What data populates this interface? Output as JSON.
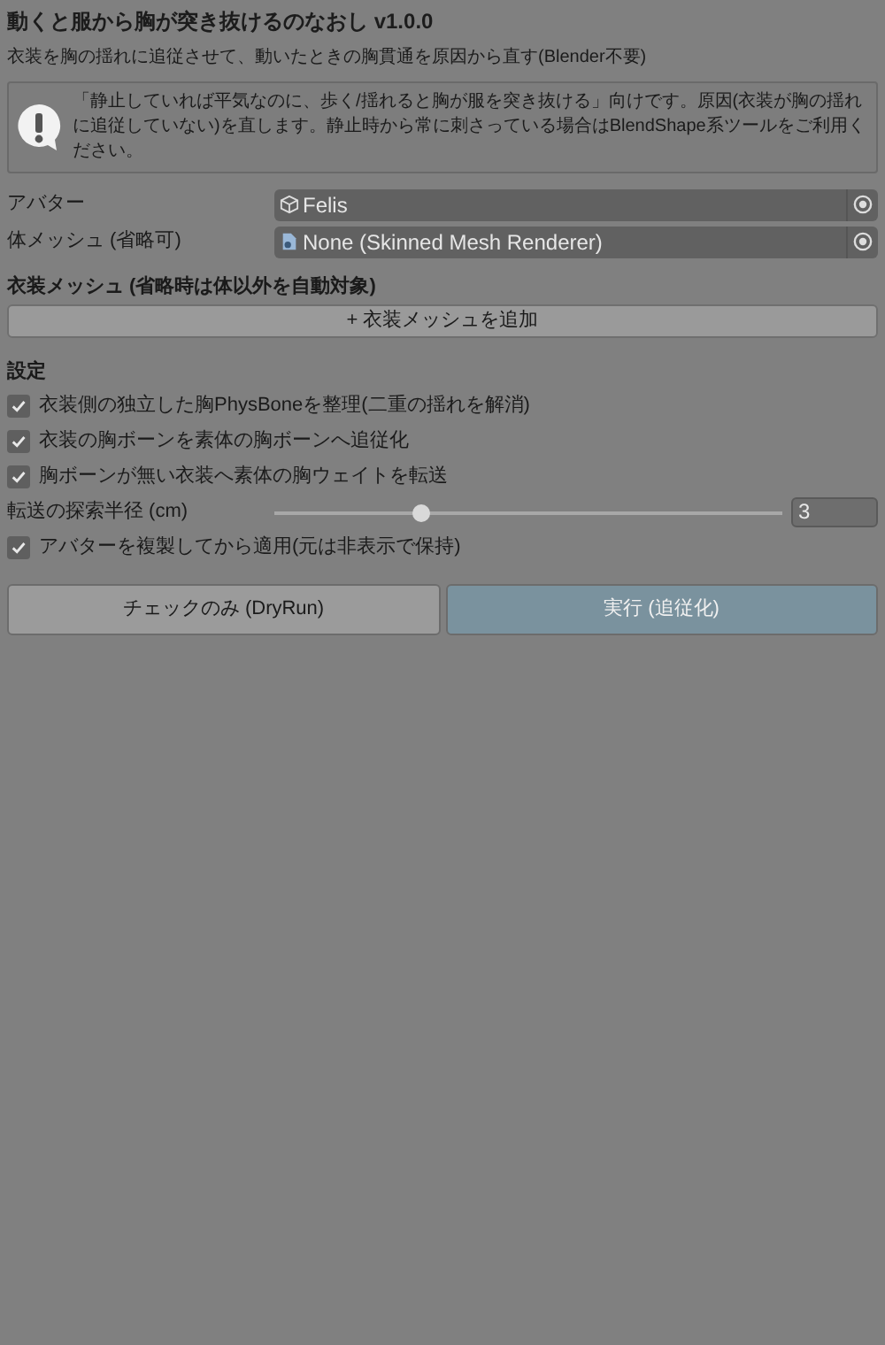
{
  "header": {
    "title": "動くと服から胸が突き抜けるのなおし v1.0.0",
    "subtitle": "衣装を胸の揺れに追従させて、動いたときの胸貫通を原因から直す(Blender不要)"
  },
  "notice": {
    "text": "「静止していれば平気なのに、歩く/揺れると胸が服を突き抜ける」向けです。原因(衣装が胸の揺れに追従していない)を直します。静止時から常に刺さっている場合はBlendShape系ツールをご利用ください。"
  },
  "fields": [
    {
      "label": "アバター",
      "value": "Felis",
      "kind": "object"
    },
    {
      "label": "体メッシュ (省略可)",
      "value": "None (Skinned Mesh Renderer)",
      "kind": "mesh"
    }
  ],
  "costume_mesh": {
    "heading": "衣装メッシュ (省略時は体以外を自動対象)",
    "add_button": "+ 衣装メッシュを追加"
  },
  "settings": {
    "heading": "設定",
    "items": [
      {
        "kind": "checkbox",
        "label": "衣装側の独立した胸PhysBoneを整理(二重の揺れを解消)",
        "checked": true
      },
      {
        "kind": "checkbox",
        "label": "衣装の胸ボーンを素体の胸ボーンへ追従化",
        "checked": true
      },
      {
        "kind": "checkbox",
        "label": "胸ボーンが無い衣装へ素体の胸ウェイトを転送",
        "checked": true
      },
      {
        "kind": "slider",
        "label": "転送の探索半径 (cm)",
        "level": 0.29,
        "value": "3"
      },
      {
        "kind": "checkbox",
        "label": "アバターを複製してから適用(元は非表示で保持)",
        "checked": true
      }
    ]
  },
  "buttons": [
    {
      "label": "チェックのみ (DryRun)",
      "kind": "default"
    },
    {
      "label": "実行 (追従化)",
      "kind": "primary"
    }
  ]
}
